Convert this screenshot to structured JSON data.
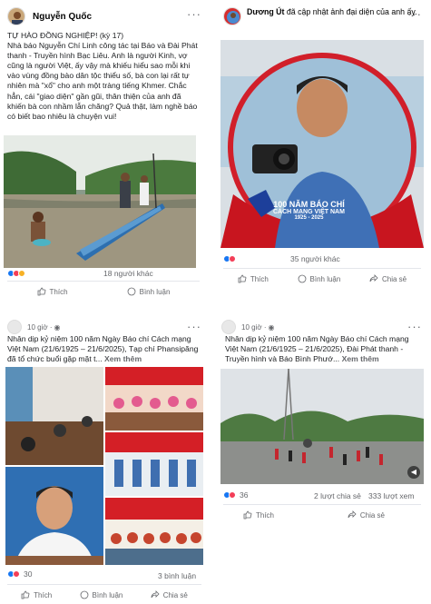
{
  "post1": {
    "author": "Nguyễn Quốc",
    "more": "···",
    "text": "TỰ HÀO ĐỒNG NGHIỆP! (kỳ 17)\nNhà báo Nguyễn Chí Linh công tác tại Báo và Đài Phát thanh - Truyền hình Bạc Liêu. Anh là người Kinh, vợ cũng là người Việt, ấy vậy mà khiếu hiểu sao mỗi khi vào vùng đồng bào dân tộc thiểu số, bà con lại rất tự nhiên mà \"xổ\" cho anh một tràng tiếng Khmer. Chắc hẳn, cái \"giao diện\" gần gũi, thân thiện của anh đã khiến bà con nhầm lẫn chăng? Quả thật, làm nghề báo có biết bao nhiêu là chuyện vui!",
    "reaction_count": "18 người khác",
    "like": "Thích",
    "comment": "Bình luận"
  },
  "post2": {
    "author": "Dương Út",
    "action": " đã cập nhật ảnh đại diện của anh ấy.",
    "more": "···",
    "frame_title": "100 NĂM BÁO CHÍ",
    "frame_sub": "CÁCH MẠNG VIỆT NAM",
    "frame_years": "1925 - 2025",
    "reaction_count": "35 người khác",
    "like": "Thích",
    "comment": "Bình luận",
    "share": "Chia sẻ"
  },
  "post3": {
    "time": "10 giờ ·",
    "text": "Nhân dịp kỷ niệm 100 năm Ngày Báo chí Cách mạng Việt Nam (21/6/1925 – 21/6/2025), Tạp chí Phansipăng đã tổ chức buổi gặp mặt t...",
    "see_more": "Xem thêm",
    "reaction_count": "30",
    "comments": "3 bình luận",
    "like": "Thích",
    "comment": "Bình luận",
    "share": "Chia sẻ"
  },
  "post4": {
    "time": "10 giờ ·",
    "text": "Nhân dịp kỷ niệm 100 năm Ngày Báo chí Cách mạng Việt Nam (21/6/1925 – 21/6/2025), Đài Phát thanh - Truyền hình và Báo Bình Phướ...",
    "see_more": "Xem thêm",
    "reaction_count": "36",
    "shares": "2 lượt chia sẻ",
    "views": "333 lượt xem",
    "like": "Thích",
    "share": "Chia sẻ"
  },
  "colors": {
    "like_blue": "#1877f2",
    "love_red": "#f33e58",
    "haha_yellow": "#f7b125",
    "gray": "#65676b"
  }
}
